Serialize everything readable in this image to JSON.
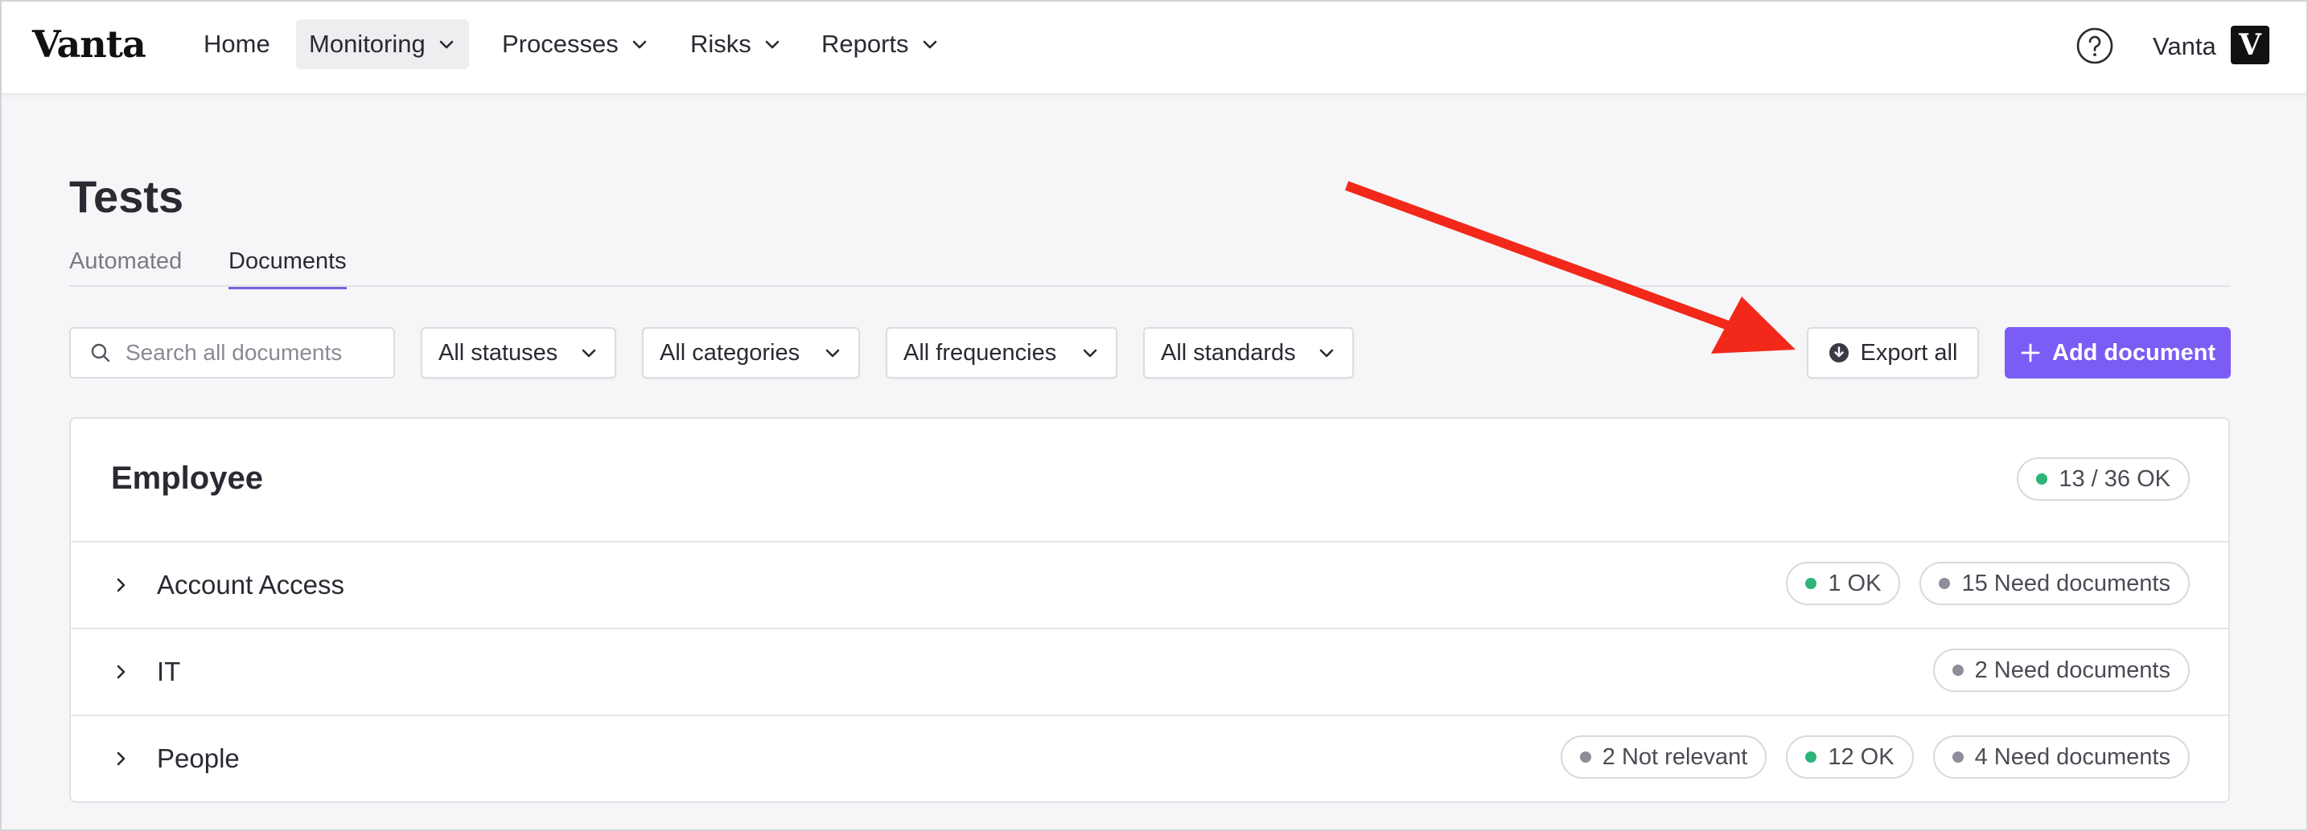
{
  "app": {
    "logo": "Vanta",
    "user": "Vanta",
    "avatar_letter": "V"
  },
  "nav": {
    "items": [
      {
        "label": "Home",
        "dropdown": false,
        "active": false
      },
      {
        "label": "Monitoring",
        "dropdown": true,
        "active": true
      },
      {
        "label": "Processes",
        "dropdown": true,
        "active": false
      },
      {
        "label": "Risks",
        "dropdown": true,
        "active": false
      },
      {
        "label": "Reports",
        "dropdown": true,
        "active": false
      }
    ]
  },
  "page": {
    "title": "Tests",
    "tabs": [
      {
        "label": "Automated",
        "active": false
      },
      {
        "label": "Documents",
        "active": true
      }
    ]
  },
  "filters": {
    "search_placeholder": "Search all documents",
    "statuses": "All statuses",
    "categories": "All categories",
    "frequencies": "All frequencies",
    "standards": "All standards"
  },
  "actions": {
    "export_label": "Export all",
    "add_label": "Add document"
  },
  "group": {
    "title": "Employee",
    "summary": {
      "text": "13 / 36 OK",
      "status": "ok"
    },
    "rows": [
      {
        "label": "Account Access",
        "badges": [
          {
            "text": "1 OK",
            "status": "ok"
          },
          {
            "text": "15 Need documents",
            "status": "neutral"
          }
        ]
      },
      {
        "label": "IT",
        "badges": [
          {
            "text": "2 Need documents",
            "status": "neutral"
          }
        ]
      },
      {
        "label": "People",
        "badges": [
          {
            "text": "2 Not relevant",
            "status": "neutral"
          },
          {
            "text": "12 OK",
            "status": "ok"
          },
          {
            "text": "4 Need documents",
            "status": "neutral"
          }
        ]
      }
    ]
  },
  "colors": {
    "accent": "#7b5cf5",
    "ok": "#2db57a",
    "neutral": "#8e8e9a",
    "annotation_arrow": "#f2281a"
  }
}
